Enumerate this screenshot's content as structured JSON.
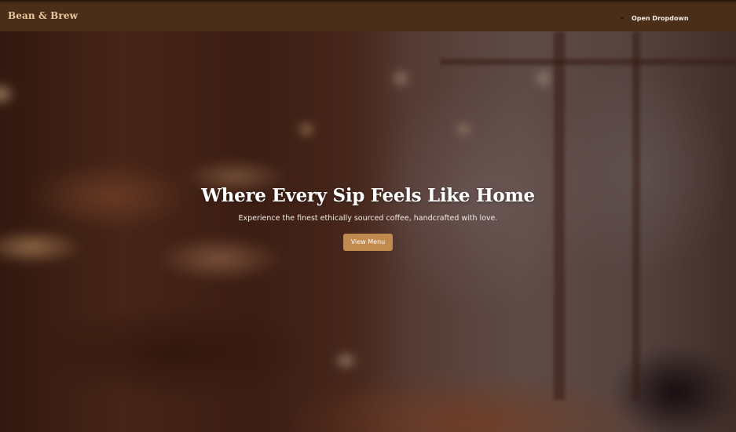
{
  "navbar": {
    "brand": "Bean & Brew",
    "dropdown_label": "Open Dropdown",
    "dropdown_icon": "caret-down-icon"
  },
  "hero": {
    "title": "Where Every Sip Feels Like Home",
    "subtitle": "Experience the finest ethically sourced coffee, handcrafted with love.",
    "cta_label": "View Menu",
    "background_image": "blurred cafe interior"
  },
  "colors": {
    "navbar_bg": "#4a2e18",
    "brand_text": "#e9c89f",
    "cta_bg": "#c18a4e",
    "cta_text": "#ffffff",
    "hero_text": "#ffffff"
  }
}
